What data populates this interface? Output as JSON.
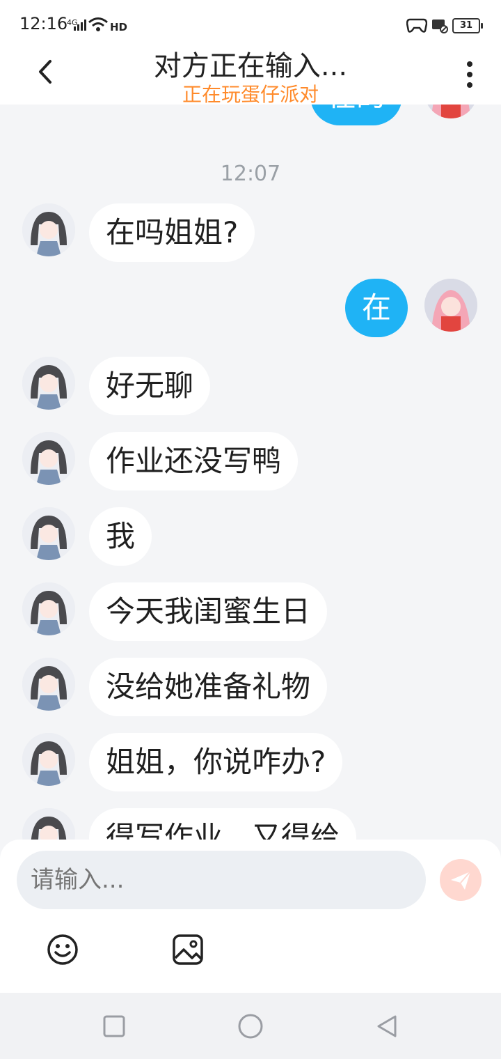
{
  "status": {
    "time": "12:16",
    "signal": "4G",
    "hd": "HD",
    "battery": "31"
  },
  "header": {
    "title": "对方正在输入...",
    "subtitle": "正在玩蛋仔派对",
    "partial_top_bubble": "在的"
  },
  "chat": {
    "timestamp": "12:07",
    "messages": [
      {
        "side": "left",
        "text": "在吗姐姐?"
      },
      {
        "side": "right",
        "text": "在"
      },
      {
        "side": "left",
        "text": "好无聊"
      },
      {
        "side": "left",
        "text": "作业还没写鸭"
      },
      {
        "side": "left",
        "text": "我"
      },
      {
        "side": "left",
        "text": "今天我闺蜜生日"
      },
      {
        "side": "left",
        "text": "没给她准备礼物"
      },
      {
        "side": "left",
        "text": "姐姐，你说咋办?"
      },
      {
        "side": "left",
        "text": "得写作业，又得给"
      }
    ]
  },
  "input": {
    "placeholder": "请输入..."
  },
  "icons": {
    "back": "chevron-left-icon",
    "more": "more-vertical-icon",
    "send": "send-icon",
    "emoji": "emoji-icon",
    "image": "image-icon",
    "nav_recent": "square-icon",
    "nav_home": "circle-icon",
    "nav_back": "triangle-back-icon"
  },
  "colors": {
    "accent_blue": "#1fb3f5",
    "subtitle_orange": "#ff8a2a",
    "background": "#f4f5f7"
  }
}
